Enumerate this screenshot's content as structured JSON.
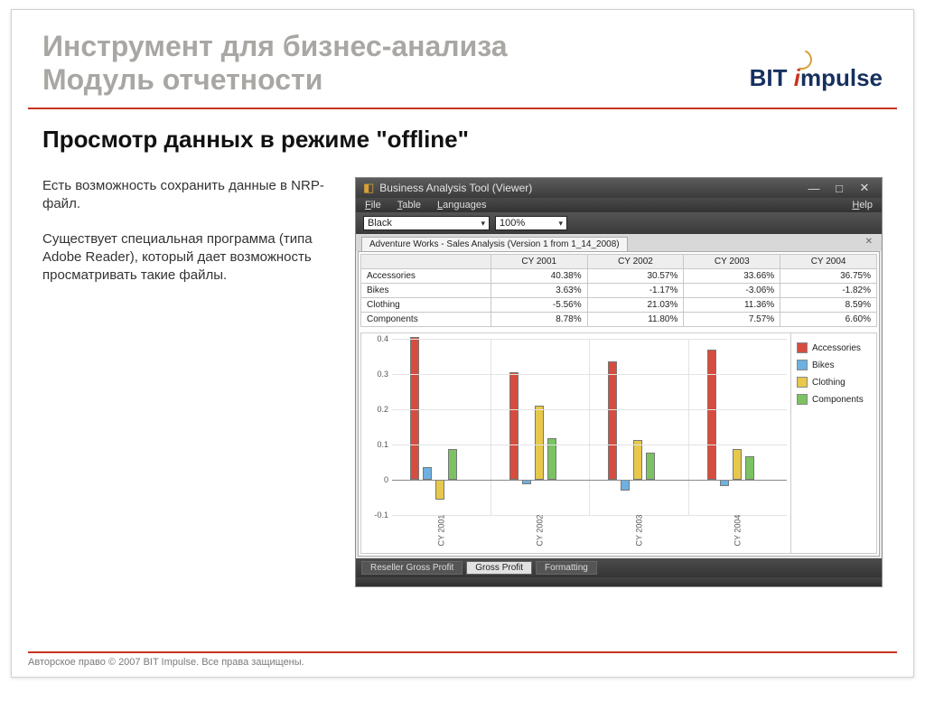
{
  "slide": {
    "title1": "Инструмент для бизнес-анализа",
    "title2": "Модуль отчетности",
    "logo_bit": "BIT",
    "logo_mpulse": "mpulse",
    "subtitle": "Просмотр данных в режиме \"offline\"",
    "para1": "Есть возможность сохранить данные в NRP-файл.",
    "para2": "Существует специальная программа (типа Adobe Reader), который дает возможность просматривать такие файлы.",
    "footer": "Авторское право © 2007 BIT Impulse. Все права защищены."
  },
  "app": {
    "title": "Business Analysis Tool (Viewer)",
    "menu": {
      "file": "File",
      "table": "Table",
      "languages": "Languages",
      "help": "Help"
    },
    "toolbar": {
      "theme": "Black",
      "zoom": "100%"
    },
    "doc_tab": "Adventure Works - Sales Analysis (Version 1 from 1_14_2008)",
    "bottom_tabs": {
      "t1": "Reseller Gross Profit",
      "t2": "Gross Profit",
      "t3": "Formatting"
    },
    "table": {
      "cols": [
        "",
        "CY 2001",
        "CY 2002",
        "CY 2003",
        "CY 2004"
      ],
      "rows": [
        {
          "label": "Accessories",
          "v": [
            "40.38%",
            "30.57%",
            "33.66%",
            "36.75%"
          ]
        },
        {
          "label": "Bikes",
          "v": [
            "3.63%",
            "-1.17%",
            "-3.06%",
            "-1.82%"
          ]
        },
        {
          "label": "Clothing",
          "v": [
            "-5.56%",
            "21.03%",
            "11.36%",
            "8.59%"
          ]
        },
        {
          "label": "Components",
          "v": [
            "8.78%",
            "11.80%",
            "7.57%",
            "6.60%"
          ]
        }
      ]
    },
    "legend": [
      "Accessories",
      "Bikes",
      "Clothing",
      "Components"
    ]
  },
  "chart_data": {
    "type": "bar",
    "categories": [
      "CY 2001",
      "CY 2002",
      "CY 2003",
      "CY 2004"
    ],
    "series": [
      {
        "name": "Accessories",
        "color": "#d64d3f",
        "values": [
          0.404,
          0.306,
          0.337,
          0.368
        ]
      },
      {
        "name": "Bikes",
        "color": "#6db1e2",
        "values": [
          0.036,
          -0.012,
          -0.031,
          -0.018
        ]
      },
      {
        "name": "Clothing",
        "color": "#e8c84b",
        "values": [
          -0.056,
          0.21,
          0.114,
          0.086
        ]
      },
      {
        "name": "Components",
        "color": "#7bc362",
        "values": [
          0.088,
          0.118,
          0.076,
          0.066
        ]
      }
    ],
    "ylim": [
      -0.1,
      0.4
    ],
    "yticks": [
      -0.1,
      0,
      0.1,
      0.2,
      0.3,
      0.4
    ],
    "title": "",
    "xlabel": "",
    "ylabel": ""
  }
}
